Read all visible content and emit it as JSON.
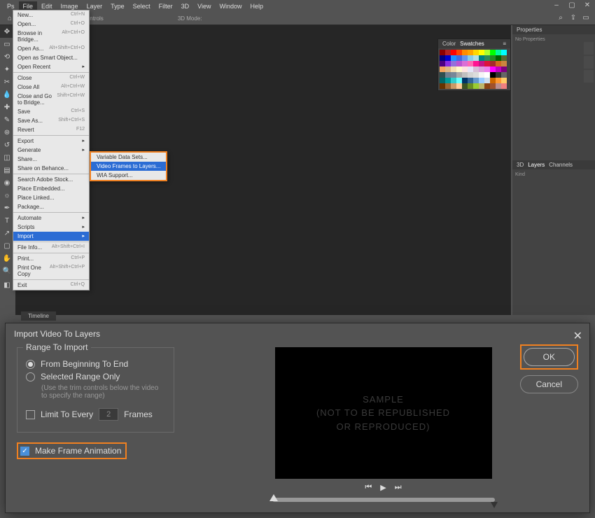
{
  "menubar": [
    "File",
    "Edit",
    "Image",
    "Layer",
    "Type",
    "Select",
    "Filter",
    "3D",
    "View",
    "Window",
    "Help"
  ],
  "options_bar": {
    "transform_label": "ree Transform Controls",
    "mode_label": "3D Mode:"
  },
  "file_menu": [
    {
      "label": "New...",
      "sc": "Ctrl+N"
    },
    {
      "label": "Open...",
      "sc": "Ctrl+O"
    },
    {
      "label": "Browse in Bridge...",
      "sc": "Alt+Ctrl+O"
    },
    {
      "label": "Open As...",
      "sc": "Alt+Shift+Ctrl+O"
    },
    {
      "label": "Open as Smart Object..."
    },
    {
      "label": "Open Recent",
      "sub": true
    },
    {
      "sep": true
    },
    {
      "label": "Close",
      "sc": "Ctrl+W"
    },
    {
      "label": "Close All",
      "sc": "Alt+Ctrl+W"
    },
    {
      "label": "Close and Go to Bridge...",
      "sc": "Shift+Ctrl+W"
    },
    {
      "label": "Save",
      "sc": "Ctrl+S"
    },
    {
      "label": "Save As...",
      "sc": "Shift+Ctrl+S"
    },
    {
      "label": "Revert",
      "sc": "F12"
    },
    {
      "sep": true
    },
    {
      "label": "Export",
      "sub": true
    },
    {
      "label": "Generate",
      "sub": true
    },
    {
      "label": "Share..."
    },
    {
      "label": "Share on Behance..."
    },
    {
      "sep": true
    },
    {
      "label": "Search Adobe Stock..."
    },
    {
      "label": "Place Embedded..."
    },
    {
      "label": "Place Linked..."
    },
    {
      "label": "Package..."
    },
    {
      "sep": true
    },
    {
      "label": "Automate",
      "sub": true
    },
    {
      "label": "Scripts",
      "sub": true
    },
    {
      "label": "Import",
      "sub": true,
      "hl": true
    },
    {
      "sep": true
    },
    {
      "label": "File Info...",
      "sc": "Alt+Shift+Ctrl+I"
    },
    {
      "sep": true
    },
    {
      "label": "Print...",
      "sc": "Ctrl+P"
    },
    {
      "label": "Print One Copy",
      "sc": "Alt+Shift+Ctrl+P"
    },
    {
      "sep": true
    },
    {
      "label": "Exit",
      "sc": "Ctrl+Q"
    }
  ],
  "import_submenu": [
    {
      "label": "Variable Data Sets..."
    },
    {
      "label": "Video Frames to Layers...",
      "hl": true
    },
    {
      "label": "WIA Support..."
    }
  ],
  "swatch_tabs": [
    "Color",
    "Swatches"
  ],
  "swatch_colors": [
    "#8b0000",
    "#b22222",
    "#ff0000",
    "#ff4500",
    "#ff8c00",
    "#ffa500",
    "#ffd700",
    "#ffff00",
    "#adff2f",
    "#00ff00",
    "#00fa9a",
    "#00ffff",
    "#000080",
    "#0000cd",
    "#1e90ff",
    "#4169e1",
    "#6495ed",
    "#87ceeb",
    "#b0e0e6",
    "#008080",
    "#2e8b57",
    "#228b22",
    "#006400",
    "#556b2f",
    "#4b0082",
    "#8a2be2",
    "#9370db",
    "#ba55d3",
    "#da70d6",
    "#ff69b4",
    "#ff1493",
    "#c71585",
    "#dc143c",
    "#a52a2a",
    "#d2691e",
    "#cd853f",
    "#f4a460",
    "#deb887",
    "#f5deb3",
    "#fffacd",
    "#ffe4e1",
    "#e6e6fa",
    "#d8bfd8",
    "#dda0dd",
    "#ee82ee",
    "#ff00ff",
    "#c000c0",
    "#800080",
    "#2f4f4f",
    "#708090",
    "#778899",
    "#a9a9a9",
    "#c0c0c0",
    "#d3d3d3",
    "#dcdcdc",
    "#f5f5f5",
    "#ffffff",
    "#000000",
    "#333333",
    "#666666",
    "#006666",
    "#009999",
    "#33cccc",
    "#66ffff",
    "#003366",
    "#336699",
    "#6699cc",
    "#99ccff",
    "#ccddee",
    "#cc6600",
    "#ff9933",
    "#ffcc66",
    "#663300",
    "#996633",
    "#cc9966",
    "#ffcc99",
    "#3b5323",
    "#6b8e23",
    "#9acd32",
    "#bdb76b",
    "#8b4513",
    "#a0522d",
    "#bc8f8f",
    "#f08080"
  ],
  "properties_tab": "Properties",
  "properties_body": "No Properties",
  "layers_tabs": [
    "3D",
    "Layers",
    "Channels"
  ],
  "layers_search": "Kind",
  "timeline_label": "Timeline",
  "dialog": {
    "title": "Import Video To Layers",
    "range_legend": "Range To Import",
    "opt_beginning": "From Beginning To End",
    "opt_selected": "Selected Range Only",
    "hint": "(Use the trim controls below the video to specify the range)",
    "limit_label": "Limit To Every",
    "frames_value": "2",
    "frames_suffix": "Frames",
    "make_anim": "Make Frame Animation",
    "watermark": {
      "l1": "SAMPLE",
      "l2": "(NOT TO BE REPUBLISHED",
      "l3": "OR REPRODUCED)"
    },
    "ok": "OK",
    "cancel": "Cancel"
  }
}
